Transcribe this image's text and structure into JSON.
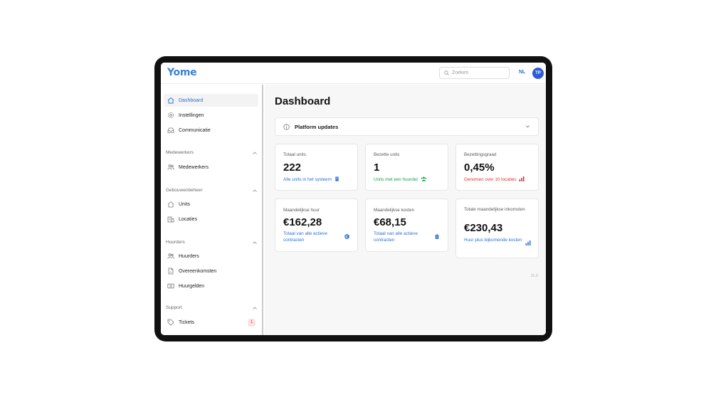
{
  "app": {
    "logo": "Yome"
  },
  "topbar": {
    "search_placeholder": "Zoeken",
    "language": "NL",
    "avatar_initials": "TP"
  },
  "sidebar": {
    "main_items": [
      {
        "label": "Dashboard",
        "icon": "home-icon",
        "active": true
      },
      {
        "label": "Instellingen",
        "icon": "gear-icon"
      },
      {
        "label": "Communicatie",
        "icon": "inbox-icon"
      }
    ],
    "sections": [
      {
        "title": "Medewerkers",
        "items": [
          {
            "label": "Medewerkers",
            "icon": "users-icon"
          }
        ]
      },
      {
        "title": "Gebouwenbeheer",
        "items": [
          {
            "label": "Units",
            "icon": "home-icon"
          },
          {
            "label": "Locaties",
            "icon": "building-icon"
          }
        ]
      },
      {
        "title": "Huurders",
        "items": [
          {
            "label": "Huurders",
            "icon": "users-icon"
          },
          {
            "label": "Overeenkomsten",
            "icon": "document-icon"
          },
          {
            "label": "Huurgelden",
            "icon": "money-icon"
          }
        ]
      },
      {
        "title": "Support",
        "items": [
          {
            "label": "Tickets",
            "icon": "tag-icon",
            "badge": "1"
          }
        ]
      }
    ]
  },
  "main": {
    "title": "Dashboard",
    "updates_label": "Platform updates",
    "cards": [
      {
        "label": "Totaal units",
        "value": "222",
        "sub": "Alle units in het systeem",
        "sub_color": "#2f6fd6",
        "icon": "building-icon"
      },
      {
        "label": "Bezette units",
        "value": "1",
        "sub": "Units met een huurder",
        "sub_color": "#1f9d4a",
        "icon": "users-icon"
      },
      {
        "label": "Bezettingsgraad",
        "value": "0,45%",
        "sub": "Genomen over 10 locaties",
        "sub_color": "#e0312f",
        "icon": "bar-chart-icon"
      },
      {
        "label": "Maandelijkse huur",
        "value": "€162,28",
        "sub": "Totaal van alle actieve contracten",
        "sub_color": "#2f6fd6",
        "icon": "euro-icon"
      },
      {
        "label": "Maandelijkse kosten",
        "value": "€68,15",
        "sub": "Totaal van alle actieve contracten",
        "sub_color": "#2f6fd6",
        "icon": "clipboard-icon"
      },
      {
        "label": "Totale maandelijkse inkomsten",
        "value": "€230,43",
        "sub": "Huur plus bijkomende kosten",
        "sub_color": "#2f6fd6",
        "icon": "bar-chart-icon"
      }
    ],
    "version": "11.0"
  },
  "colors": {
    "accent": "#2f6fd6",
    "success": "#1f9d4a",
    "danger": "#e0312f"
  }
}
